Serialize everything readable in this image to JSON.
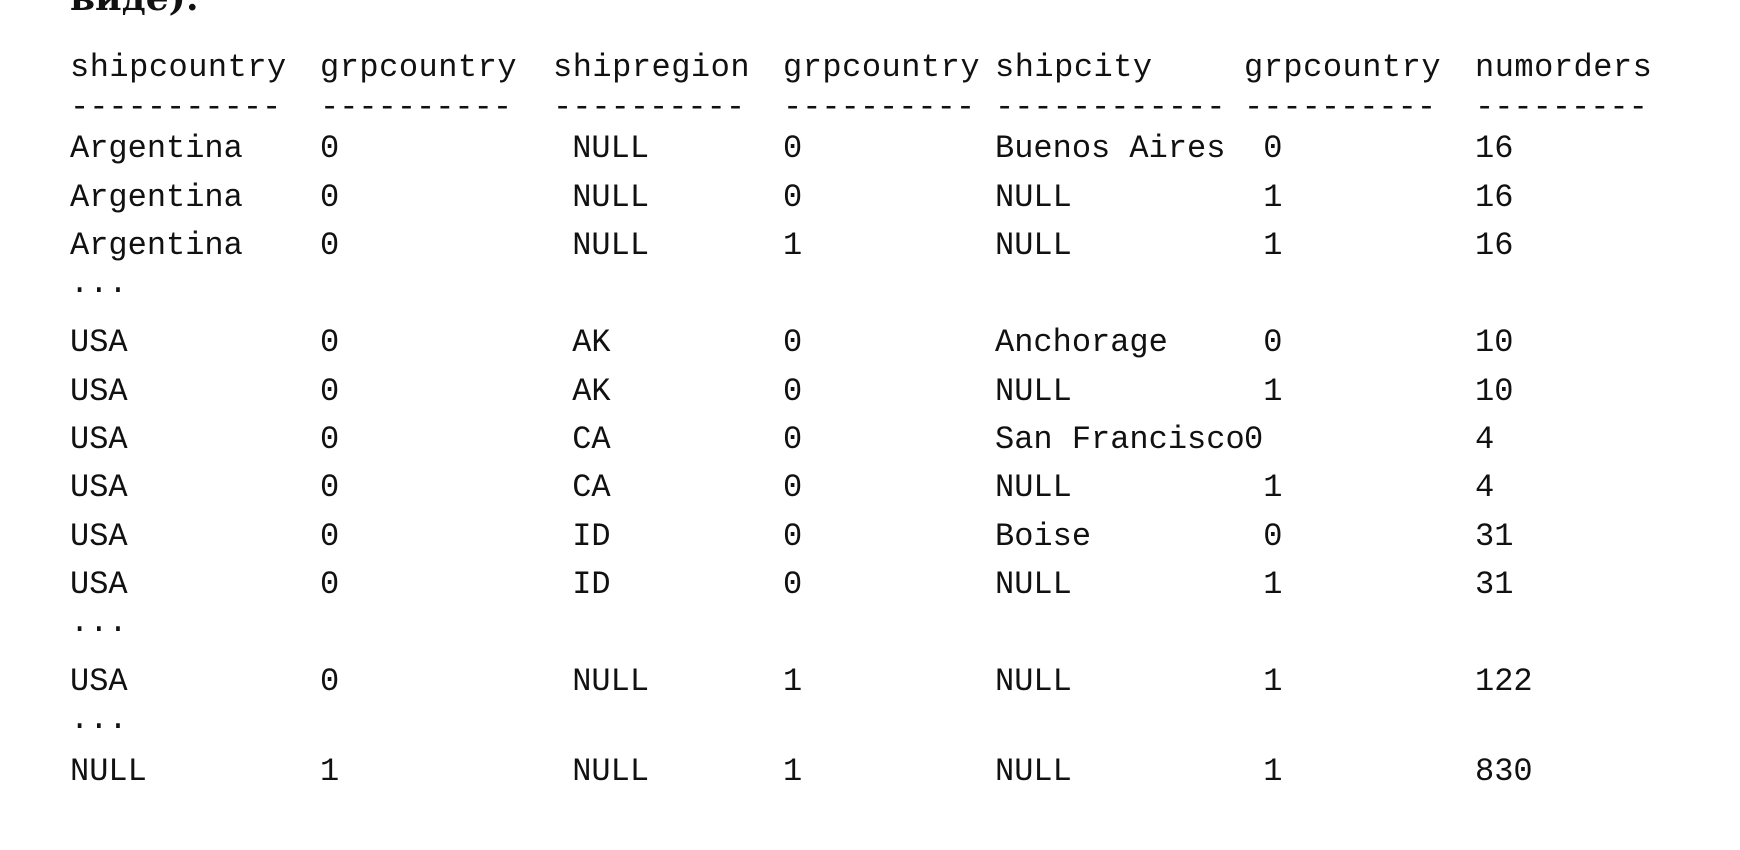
{
  "page_fragment": "виде):",
  "result": {
    "headers": [
      "shipcountry",
      "grpcountry",
      "shipregion",
      "grpcountry",
      "shipcity",
      "grpcountry",
      "numorders"
    ],
    "separators": [
      "-----------",
      "----------",
      "----------",
      "----------",
      "------------",
      "----------",
      "---------"
    ],
    "rows": [
      {
        "type": "data",
        "cells": [
          "Argentina",
          "0",
          " NULL",
          "0",
          "Buenos Aires",
          " 0",
          "16"
        ]
      },
      {
        "type": "data",
        "cells": [
          "Argentina",
          "0",
          " NULL",
          "0",
          "NULL",
          " 1",
          "16"
        ]
      },
      {
        "type": "data",
        "cells": [
          "Argentina",
          "0",
          " NULL",
          "1",
          "NULL",
          " 1",
          "16"
        ]
      },
      {
        "type": "ellipsis",
        "text": "..."
      },
      {
        "type": "data",
        "cells": [
          "USA",
          "0",
          " AK",
          "0",
          "Anchorage",
          " 0",
          "10"
        ]
      },
      {
        "type": "data",
        "cells": [
          "USA",
          "0",
          " AK",
          "0",
          "NULL",
          " 1",
          "10"
        ]
      },
      {
        "type": "data",
        "cells": [
          "USA",
          "0",
          " CA",
          "0",
          "San Francisco",
          "0",
          "4"
        ]
      },
      {
        "type": "data",
        "cells": [
          "USA",
          "0",
          " CA",
          "0",
          "NULL",
          " 1",
          "4"
        ]
      },
      {
        "type": "data",
        "cells": [
          "USA",
          "0",
          " ID",
          "0",
          "Boise",
          " 0",
          "31"
        ]
      },
      {
        "type": "data",
        "cells": [
          "USA",
          "0",
          " ID",
          "0",
          "NULL",
          " 1",
          "31"
        ]
      },
      {
        "type": "ellipsis",
        "text": "..."
      },
      {
        "type": "data",
        "cells": [
          "USA",
          "0",
          " NULL",
          "1",
          "NULL",
          " 1",
          "122"
        ]
      },
      {
        "type": "ellipsis",
        "text": "..."
      },
      {
        "type": "data",
        "cells": [
          "NULL",
          "1",
          " NULL",
          "1",
          "NULL",
          " 1",
          "830"
        ]
      }
    ]
  }
}
